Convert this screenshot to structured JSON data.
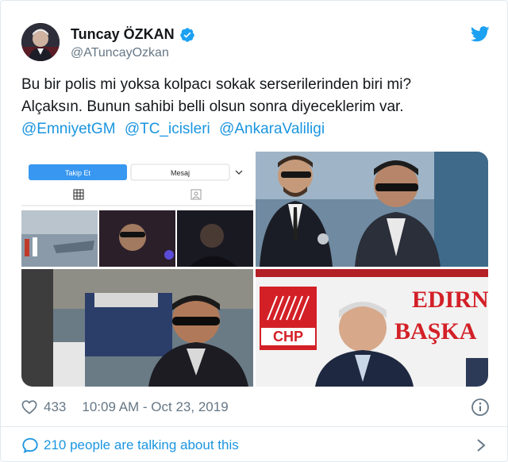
{
  "user": {
    "display_name": "Tuncay ÖZKAN",
    "handle": "@ATuncayOzkan"
  },
  "tweet": {
    "line1": "Bu bir polis mi yoksa kolpacı sokak serserilerinden biri mi?",
    "line2": "Alçaksın. Bunun sahibi belli olsun sonra diyeceklerim var.",
    "mentions": [
      "@EmniyetGM",
      "@TC_icisleri",
      "@AnkaraValiligi"
    ]
  },
  "media": {
    "profile_follow_label": "Takip Et",
    "profile_message_label": "Mesaj",
    "chp_sign_text": "CHP",
    "banner_line1": "EDIRN",
    "banner_line2": "BAŞKA"
  },
  "footer": {
    "like_count": "433",
    "timestamp": "10:09 AM - Oct 23, 2019"
  },
  "conversation": {
    "label": "210 people are talking about this"
  },
  "icons": {
    "verified": "verified-badge-icon",
    "twitter": "twitter-bird-icon",
    "like": "heart-icon",
    "info": "info-icon",
    "reply": "speech-bubble-icon",
    "chevron": "chevron-right-icon"
  },
  "colors": {
    "link_blue": "#1b95e0",
    "text_primary": "#14171a",
    "text_secondary": "#657786",
    "chp_red": "#d32027"
  }
}
